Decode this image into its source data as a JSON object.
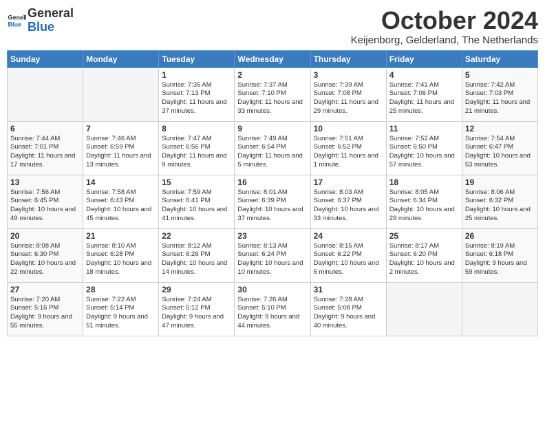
{
  "header": {
    "logo_general": "General",
    "logo_blue": "Blue",
    "month": "October 2024",
    "location": "Keijenborg, Gelderland, The Netherlands"
  },
  "days_of_week": [
    "Sunday",
    "Monday",
    "Tuesday",
    "Wednesday",
    "Thursday",
    "Friday",
    "Saturday"
  ],
  "weeks": [
    [
      {
        "num": "",
        "info": ""
      },
      {
        "num": "",
        "info": ""
      },
      {
        "num": "1",
        "info": "Sunrise: 7:35 AM\nSunset: 7:13 PM\nDaylight: 11 hours and 37 minutes."
      },
      {
        "num": "2",
        "info": "Sunrise: 7:37 AM\nSunset: 7:10 PM\nDaylight: 11 hours and 33 minutes."
      },
      {
        "num": "3",
        "info": "Sunrise: 7:39 AM\nSunset: 7:08 PM\nDaylight: 11 hours and 29 minutes."
      },
      {
        "num": "4",
        "info": "Sunrise: 7:41 AM\nSunset: 7:06 PM\nDaylight: 11 hours and 25 minutes."
      },
      {
        "num": "5",
        "info": "Sunrise: 7:42 AM\nSunset: 7:03 PM\nDaylight: 11 hours and 21 minutes."
      }
    ],
    [
      {
        "num": "6",
        "info": "Sunrise: 7:44 AM\nSunset: 7:01 PM\nDaylight: 11 hours and 17 minutes."
      },
      {
        "num": "7",
        "info": "Sunrise: 7:46 AM\nSunset: 6:59 PM\nDaylight: 11 hours and 13 minutes."
      },
      {
        "num": "8",
        "info": "Sunrise: 7:47 AM\nSunset: 6:56 PM\nDaylight: 11 hours and 9 minutes."
      },
      {
        "num": "9",
        "info": "Sunrise: 7:49 AM\nSunset: 6:54 PM\nDaylight: 11 hours and 5 minutes."
      },
      {
        "num": "10",
        "info": "Sunrise: 7:51 AM\nSunset: 6:52 PM\nDaylight: 11 hours and 1 minute."
      },
      {
        "num": "11",
        "info": "Sunrise: 7:52 AM\nSunset: 6:50 PM\nDaylight: 10 hours and 57 minutes."
      },
      {
        "num": "12",
        "info": "Sunrise: 7:54 AM\nSunset: 6:47 PM\nDaylight: 10 hours and 53 minutes."
      }
    ],
    [
      {
        "num": "13",
        "info": "Sunrise: 7:56 AM\nSunset: 6:45 PM\nDaylight: 10 hours and 49 minutes."
      },
      {
        "num": "14",
        "info": "Sunrise: 7:58 AM\nSunset: 6:43 PM\nDaylight: 10 hours and 45 minutes."
      },
      {
        "num": "15",
        "info": "Sunrise: 7:59 AM\nSunset: 6:41 PM\nDaylight: 10 hours and 41 minutes."
      },
      {
        "num": "16",
        "info": "Sunrise: 8:01 AM\nSunset: 6:39 PM\nDaylight: 10 hours and 37 minutes."
      },
      {
        "num": "17",
        "info": "Sunrise: 8:03 AM\nSunset: 6:37 PM\nDaylight: 10 hours and 33 minutes."
      },
      {
        "num": "18",
        "info": "Sunrise: 8:05 AM\nSunset: 6:34 PM\nDaylight: 10 hours and 29 minutes."
      },
      {
        "num": "19",
        "info": "Sunrise: 8:06 AM\nSunset: 6:32 PM\nDaylight: 10 hours and 25 minutes."
      }
    ],
    [
      {
        "num": "20",
        "info": "Sunrise: 8:08 AM\nSunset: 6:30 PM\nDaylight: 10 hours and 22 minutes."
      },
      {
        "num": "21",
        "info": "Sunrise: 8:10 AM\nSunset: 6:28 PM\nDaylight: 10 hours and 18 minutes."
      },
      {
        "num": "22",
        "info": "Sunrise: 8:12 AM\nSunset: 6:26 PM\nDaylight: 10 hours and 14 minutes."
      },
      {
        "num": "23",
        "info": "Sunrise: 8:13 AM\nSunset: 6:24 PM\nDaylight: 10 hours and 10 minutes."
      },
      {
        "num": "24",
        "info": "Sunrise: 8:15 AM\nSunset: 6:22 PM\nDaylight: 10 hours and 6 minutes."
      },
      {
        "num": "25",
        "info": "Sunrise: 8:17 AM\nSunset: 6:20 PM\nDaylight: 10 hours and 2 minutes."
      },
      {
        "num": "26",
        "info": "Sunrise: 8:19 AM\nSunset: 6:18 PM\nDaylight: 9 hours and 59 minutes."
      }
    ],
    [
      {
        "num": "27",
        "info": "Sunrise: 7:20 AM\nSunset: 5:16 PM\nDaylight: 9 hours and 55 minutes."
      },
      {
        "num": "28",
        "info": "Sunrise: 7:22 AM\nSunset: 5:14 PM\nDaylight: 9 hours and 51 minutes."
      },
      {
        "num": "29",
        "info": "Sunrise: 7:24 AM\nSunset: 5:12 PM\nDaylight: 9 hours and 47 minutes."
      },
      {
        "num": "30",
        "info": "Sunrise: 7:26 AM\nSunset: 5:10 PM\nDaylight: 9 hours and 44 minutes."
      },
      {
        "num": "31",
        "info": "Sunrise: 7:28 AM\nSunset: 5:08 PM\nDaylight: 9 hours and 40 minutes."
      },
      {
        "num": "",
        "info": ""
      },
      {
        "num": "",
        "info": ""
      }
    ]
  ]
}
